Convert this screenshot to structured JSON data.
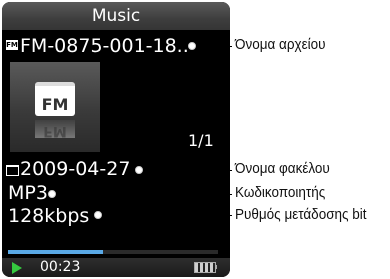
{
  "header": {
    "title": "Music"
  },
  "track": {
    "file_icon_label": "FM",
    "file_name": "FM-0875-001-18..",
    "art_text": "FM",
    "track_index": "1/1",
    "folder_name": "2009-04-27",
    "codec": "MP3",
    "bitrate": "128kbps"
  },
  "playback": {
    "progress_fraction": 0.45,
    "elapsed": "00:23",
    "status": "playing"
  },
  "callouts": {
    "file_name": "Όνομα αρχείου",
    "folder_name": "Όνομα φακέλου",
    "codec": "Κωδικοποιητής",
    "bitrate": "Ρυθμός μετάδοσης bit"
  },
  "colors": {
    "screen_bg": "#000000",
    "progress": "#5aa9e6",
    "play_icon": "#35c93f"
  }
}
